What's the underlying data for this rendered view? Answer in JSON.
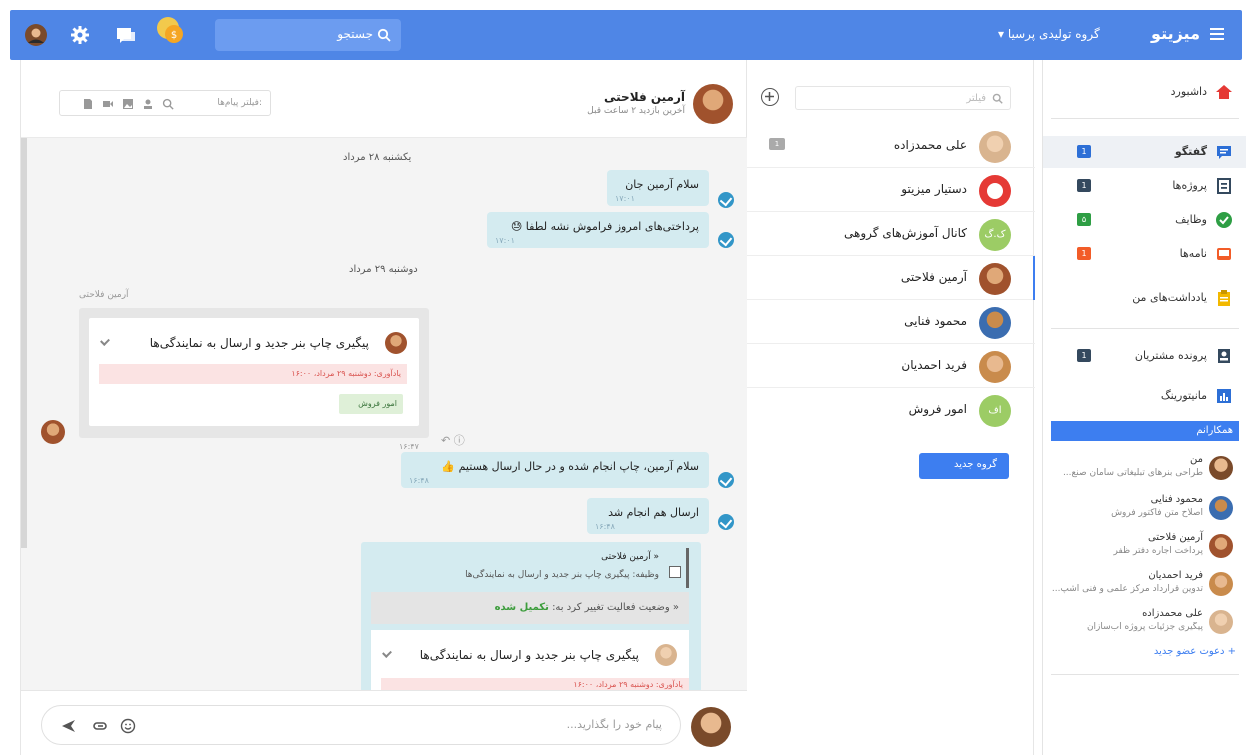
{
  "topbar": {
    "brand": "میزیتو",
    "company": "گروه تولیدی پرسیا ▾",
    "search_label": "جستجو",
    "icons": [
      "user-avatar-icon",
      "gear-icon",
      "chat-icon",
      "coin-icon"
    ]
  },
  "sidebar": {
    "items": [
      {
        "label": "داشبورد",
        "icon": "home-icon",
        "color": "#e53935"
      },
      {
        "label": "گفتگو",
        "icon": "chat-icon",
        "badge": "1",
        "badge_color": "#2d6fd6",
        "color": "#2d6fd6"
      },
      {
        "label": "پروژه‌ها",
        "icon": "projects-icon",
        "badge": "1",
        "badge_color": "#34495e",
        "color": "#34495e"
      },
      {
        "label": "وظایف",
        "icon": "check-icon",
        "badge": "۵",
        "badge_color": "#2e9e44",
        "color": "#2e9e44"
      },
      {
        "label": "نامه‌ها",
        "icon": "inbox-icon",
        "badge": "1",
        "badge_color": "#f25c28",
        "color": "#f25c28"
      },
      {
        "label": "یادداشت‌های من",
        "icon": "note-icon",
        "color": "#f2b800"
      },
      {
        "label": "پرونده مشتریان",
        "icon": "contacts-icon",
        "badge": "1",
        "badge_color": "#34495e",
        "color": "#34495e"
      },
      {
        "label": "مانیتورینگ",
        "icon": "chart-icon",
        "color": "#2d6fd6"
      }
    ],
    "colleagues_title": "همکارانم",
    "colleagues": [
      {
        "name": "من",
        "sub": "طراحی بنرهای تبلیغاتی سامان صنع..."
      },
      {
        "name": "محمود فنایی",
        "sub": "اصلاح متن فاکتور فروش"
      },
      {
        "name": "آرمین فلاحتی",
        "sub": "پرداخت اجاره دفتر ظفر"
      },
      {
        "name": "فرید احمدیان",
        "sub": "تدوین قرارداد مرکز علمی و فنی آشپ..."
      },
      {
        "name": "علی محمدزاده",
        "sub": "پیگیری جزئیات پروژه آب‌سازان"
      }
    ],
    "invite": "+ دعوت عضو جدید"
  },
  "conversations": {
    "filter_placeholder": "فیلتر",
    "items": [
      {
        "name": "علی محمدزاده",
        "count": "1",
        "color": "#d9b48f"
      },
      {
        "name": "دستیار میزیتو",
        "color": "#e53935"
      },
      {
        "name": "کانال آموزش‌های گروهی",
        "initials": "ک.گ",
        "color": "#8bc34a"
      },
      {
        "name": "آرمین فلاحتی",
        "color": "#a0522d",
        "active": true
      },
      {
        "name": "محمود فنایی",
        "color": "#3b6db0"
      },
      {
        "name": "فرید احمدیان",
        "color": "#c98b4c"
      },
      {
        "name": "امور فروش",
        "initials": "اف",
        "color": "#8bc34a"
      }
    ],
    "new_group": "گروه جدید"
  },
  "chat": {
    "name": "آرمین فلاحتی",
    "status": "آخرین بازدید ۲ ساعت قبل",
    "filter_placeholder": "فیلتر پیام‌ها:",
    "day1": "یکشنبه ۲۸ مرداد",
    "day2": "دوشنبه ۲۹ مرداد",
    "msg1": {
      "text": "سلام آرمین جان",
      "time": "۱۷:۰۱"
    },
    "msg2": {
      "text": "پرداختی‌های امروز فراموش نشه لطفا 😓",
      "time": "۱۷:۰۱"
    },
    "sender_label": "آرمین فلاحتی",
    "task": {
      "title": "پیگیری چاپ بنر جدید و ارسال به نمایندگی‌ها",
      "reminder": "یادآوری: دوشنبه ۲۹ مرداد، ۱۶:۰۰",
      "tag": "امور فروش",
      "time": "۱۶:۴۷"
    },
    "msg3": {
      "text": "سلام آرمین، چاپ انجام شده و در حال ارسال هستیم 👍",
      "time": "۱۶:۴۸"
    },
    "msg4": {
      "text": "ارسال هم انجام شد",
      "time": "۱۶:۴۸"
    },
    "activity": {
      "author": "« آرمین فلاحتی",
      "task_line": "وظیفه: پیگیری چاپ بنر جدید و ارسال به نمایندگی‌ها",
      "status_prefix": "« وضعیت فعالیت تغییر کرد به:",
      "status_value": "تکمیل شده",
      "task_title": "پیگیری چاپ بنر جدید و ارسال به نمایندگی‌ها",
      "reminder": "یادآوری: دوشنبه ۲۹ مرداد، ۱۶:۰۰"
    },
    "composer_placeholder": "پیام خود را بگذارید..."
  }
}
